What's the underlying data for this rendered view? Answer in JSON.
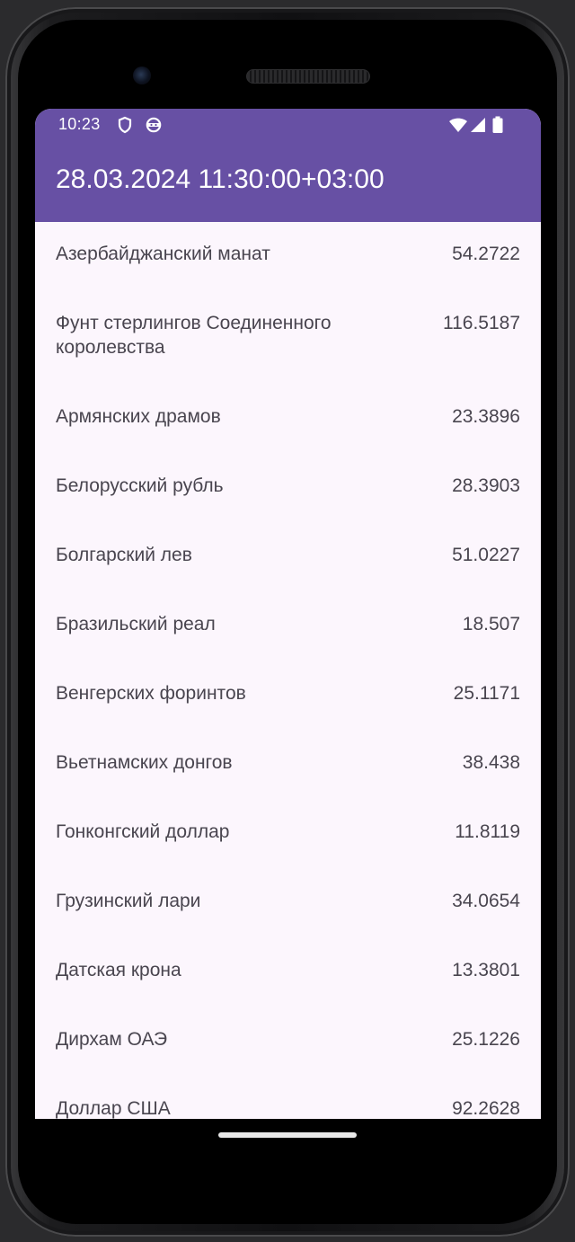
{
  "status_bar": {
    "time": "10:23",
    "icons": [
      "shield-icon",
      "android-face-icon",
      "wifi-icon",
      "cell-signal-icon",
      "battery-icon"
    ]
  },
  "app_bar": {
    "title": "28.03.2024 11:30:00+03:00",
    "color": "#6750a4"
  },
  "currencies": [
    {
      "name": "Азербайджанский манат",
      "value": "54.2722"
    },
    {
      "name": "Фунт стерлингов Соединенного королевства",
      "value": "116.5187"
    },
    {
      "name": "Армянских драмов",
      "value": "23.3896"
    },
    {
      "name": "Белорусский рубль",
      "value": "28.3903"
    },
    {
      "name": "Болгарский лев",
      "value": "51.0227"
    },
    {
      "name": "Бразильский реал",
      "value": "18.507"
    },
    {
      "name": "Венгерских форинтов",
      "value": "25.1171"
    },
    {
      "name": "Вьетнамских донгов",
      "value": "38.438"
    },
    {
      "name": "Гонконгский доллар",
      "value": "11.8119"
    },
    {
      "name": "Грузинский лари",
      "value": "34.0654"
    },
    {
      "name": "Датская крона",
      "value": "13.3801"
    },
    {
      "name": "Дирхам ОАЭ",
      "value": "25.1226"
    },
    {
      "name": "Доллар США",
      "value": "92.2628"
    }
  ]
}
